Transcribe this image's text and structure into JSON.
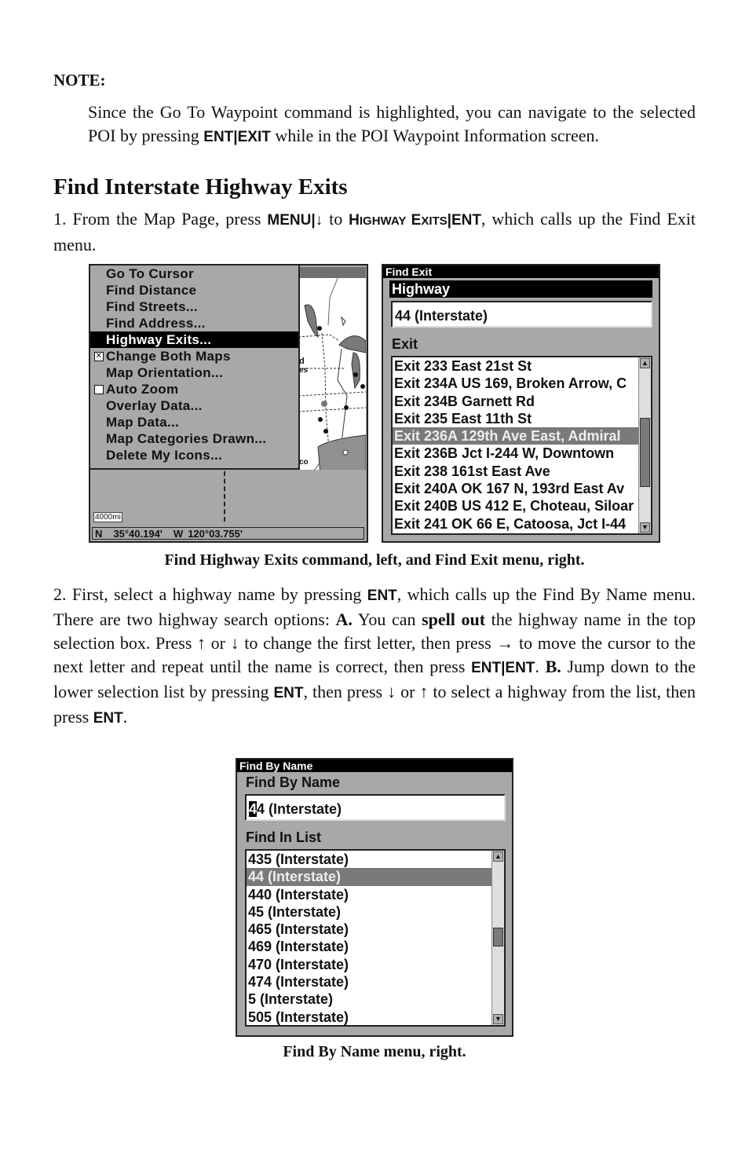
{
  "note": {
    "label": "NOTE:",
    "text_before": "Since the Go To Waypoint command is highlighted, you can navigate to the selected POI by pressing ",
    "key": "ENT|EXIT",
    "text_after": " while in the POI Waypoint Information screen."
  },
  "section_title": "Find Interstate Highway Exits",
  "step1": {
    "t1": "1. From the Map Page, press ",
    "k1": "MENU|↓",
    "t2": " to ",
    "k2a": "H",
    "k2b": "IGHWAY ",
    "k2c": "E",
    "k2d": "XITS",
    "k3": "|ENT",
    "t3": ", which calls up the Find Exit menu."
  },
  "left_screen": {
    "menu_items": [
      {
        "label": "Go To Cursor",
        "selected": false,
        "checkbox": null
      },
      {
        "label": "Find Distance",
        "selected": false,
        "checkbox": null
      },
      {
        "label": "Find Streets...",
        "selected": false,
        "checkbox": null
      },
      {
        "label": "Find Address...",
        "selected": false,
        "checkbox": null
      },
      {
        "label": "Highway Exits...",
        "selected": true,
        "checkbox": null
      },
      {
        "label": "Change Both Maps",
        "selected": false,
        "checkbox": "checked"
      },
      {
        "label": "Map Orientation...",
        "selected": false,
        "checkbox": null
      },
      {
        "label": "Auto Zoom",
        "selected": false,
        "checkbox": "unchecked"
      },
      {
        "label": "Overlay Data...",
        "selected": false,
        "checkbox": null
      },
      {
        "label": "Map Data...",
        "selected": false,
        "checkbox": null
      },
      {
        "label": "Map Categories Drawn...",
        "selected": false,
        "checkbox": null
      },
      {
        "label": "Delete My Icons...",
        "selected": false,
        "checkbox": null
      }
    ],
    "map_labels": [
      "d",
      "es",
      "co"
    ],
    "scale": "4000mi",
    "lat_hemi": "N",
    "lat": "35°40.194'",
    "lon_hemi": "W",
    "lon": "120°03.755'"
  },
  "find_exit": {
    "title": "Find Exit",
    "highway_label": "Highway",
    "highway_value": "44 (Interstate)",
    "exit_label": "Exit",
    "exits": [
      "Exit 233 East 21st St",
      "Exit 234A US 169, Broken Arrow, C",
      "Exit 234B Garnett Rd",
      "Exit 235 East 11th St",
      "Exit 236A 129th Ave East, Admiral",
      "Exit 236B Jct I-244 W, Downtown",
      "Exit 238 161st East Ave",
      "Exit 240A OK 167 N, 193rd East Av",
      "Exit 240B US 412 E, Choteau, Siloar",
      "Exit 241 OK 66 E, Catoosa, Jct I-44"
    ],
    "selected_index": 4
  },
  "caption1": "Find Highway Exits command, left, and Find Exit menu, right.",
  "step2": {
    "t1": "2. First, select a highway name by pressing ",
    "k1": "ENT",
    "t2": ", which calls up the Find By Name menu. There are two highway search options: ",
    "b1": "A.",
    "t3": " You can ",
    "b2": "spell out",
    "t4": " the highway name in the top selection box. Press ↑ or ↓ to change the first letter, then press → to move the cursor to the next letter and repeat until the name is correct, then press ",
    "k2": "ENT|ENT",
    "t5": ". ",
    "b3": "B.",
    "t6": " Jump down to the lower selection list by pressing ",
    "k3": "ENT",
    "t7": ", then press ↓ or ↑ to select a highway from the list, then press ",
    "k4": "ENT",
    "t8": "."
  },
  "find_by_name": {
    "title": "Find By Name",
    "name_label": "Find By Name",
    "name_cursor_char": "4",
    "name_rest": "4 (Interstate)",
    "list_label": "Find In List",
    "items": [
      "435 (Interstate)",
      "44 (Interstate)",
      "440 (Interstate)",
      "45 (Interstate)",
      "465 (Interstate)",
      "469 (Interstate)",
      "470 (Interstate)",
      "474 (Interstate)",
      "5 (Interstate)",
      "505 (Interstate)"
    ],
    "selected_index": 1
  },
  "caption2": "Find By Name menu, right."
}
